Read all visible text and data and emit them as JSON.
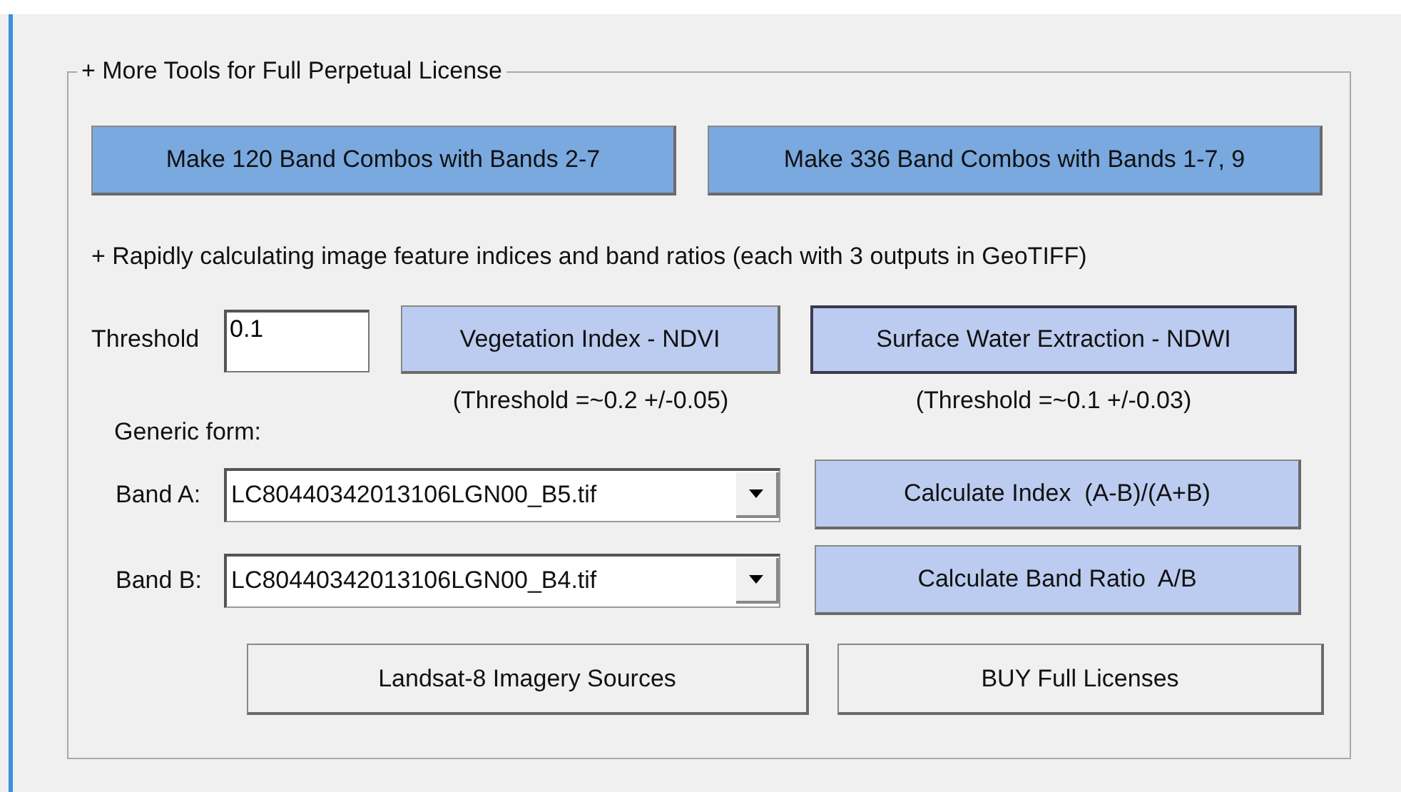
{
  "group": {
    "title": "+ More Tools for Full Perpetual License"
  },
  "combo_buttons": [
    {
      "label": "Make 120 Band Combos with Bands 2-7"
    },
    {
      "label": "Make 336 Band Combos with Bands 1-7, 9"
    }
  ],
  "description": "+ Rapidly calculating image feature indices and band ratios (each with 3 outputs in GeoTIFF)",
  "threshold": {
    "label": "Threshold",
    "value": "0.1"
  },
  "index_buttons": [
    {
      "label": "Vegetation Index - NDVI",
      "note": "(Threshold =~0.2 +/-0.05)",
      "focused": false
    },
    {
      "label": "Surface Water Extraction - NDWI",
      "note": "(Threshold =~0.1 +/-0.03)",
      "focused": true
    }
  ],
  "generic_form_label": "Generic form:",
  "bands": [
    {
      "label": "Band A:",
      "value": "LC80440342013106LGN00_B5.tif",
      "button": "Calculate Index  (A-B)/(A+B)"
    },
    {
      "label": "Band B:",
      "value": "LC80440342013106LGN00_B4.tif",
      "button": "Calculate Band Ratio  A/B"
    }
  ],
  "bottom_buttons": [
    "Landsat-8 Imagery Sources",
    "BUY Full Licenses"
  ]
}
